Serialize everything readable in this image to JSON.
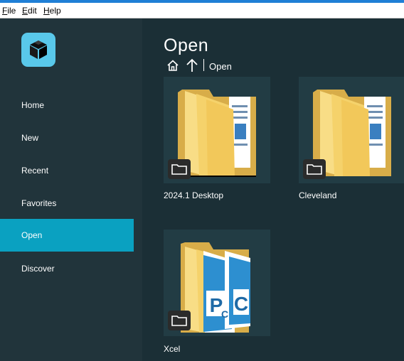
{
  "menubar": {
    "file": {
      "acc": "F",
      "rest": "ile"
    },
    "edit": {
      "acc": "E",
      "rest": "dit"
    },
    "help": {
      "acc": "H",
      "rest": "elp"
    }
  },
  "sidebar": {
    "logo_icon": "cube-logo-icon",
    "items": [
      {
        "label": "Home",
        "active": false
      },
      {
        "label": "New",
        "active": false
      },
      {
        "label": "Recent",
        "active": false
      },
      {
        "label": "Favorites",
        "active": false
      },
      {
        "label": "Open",
        "active": true
      },
      {
        "label": "Discover",
        "active": false
      }
    ]
  },
  "main": {
    "title": "Open",
    "breadcrumb": {
      "home_icon": "home-icon",
      "up_icon": "arrow-up-icon",
      "current": "Open"
    },
    "folders": [
      {
        "name": "2024.1 Desktop",
        "icon": "folder-with-documents-icon"
      },
      {
        "name": "Cleveland",
        "icon": "folder-with-documents-icon"
      },
      {
        "name": "Xcel",
        "icon": "folder-with-pc-files-icon"
      }
    ]
  },
  "colors": {
    "sidebar_bg": "#21343b",
    "main_bg": "#1b2f36",
    "active_nav": "#0aa1c1",
    "logo_bg": "#59c8ea",
    "tile_bg": "#223c44",
    "folder_yellow": "#f5d26b"
  }
}
